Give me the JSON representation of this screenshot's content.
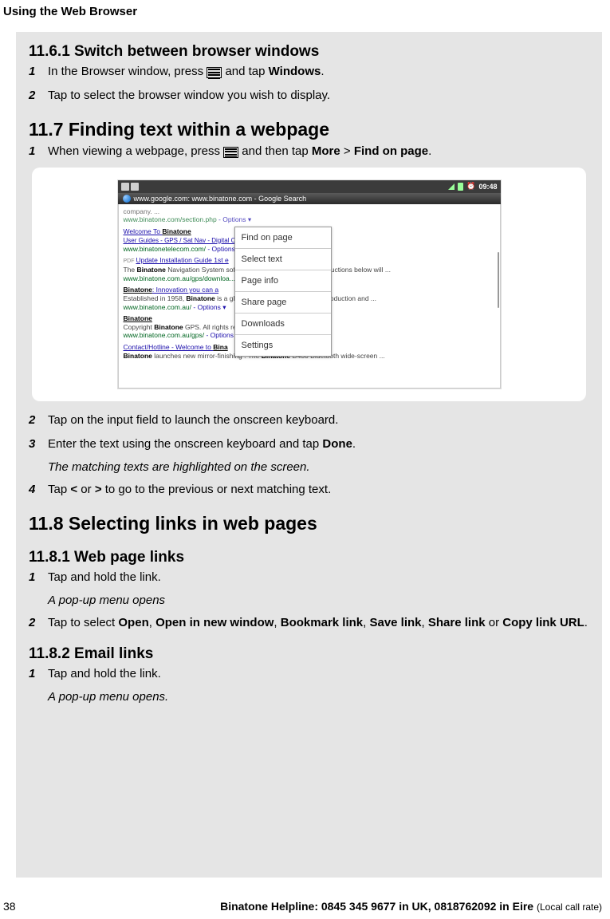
{
  "header": {
    "title": "Using the Web Browser"
  },
  "s1161": {
    "heading": "11.6.1 Switch between browser windows",
    "step1_a": "In the Browser window, press ",
    "step1_b": " and tap ",
    "step1_bold": "Windows",
    "step1_c": ".",
    "step2": "Tap to select the browser window you wish to display."
  },
  "s117": {
    "heading": "11.7   Finding text within a webpage",
    "step1_a": "When viewing a webpage, press ",
    "step1_b": "  and then tap ",
    "step1_bold1": "More",
    "step1_gt": " > ",
    "step1_bold2": "Find on page",
    "step1_c": ".",
    "step2": "Tap on the input field to launch the onscreen keyboard.",
    "step3_a": "Enter the text using the onscreen keyboard and tap ",
    "step3_bold": "Done",
    "step3_b": ".",
    "result3": "The matching texts are highlighted on the screen.",
    "step4_a": "Tap ",
    "step4_lt": "<",
    "step4_or": " or ",
    "step4_gt2": ">",
    "step4_b": " to go to the previous or next matching text."
  },
  "s118": {
    "heading": "11.8   Selecting links in web pages"
  },
  "s1181": {
    "heading": "11.8.1 Web page links",
    "step1": "Tap and hold the link.",
    "result1": "A pop-up menu opens",
    "step2_a": "Tap to select ",
    "o1": "Open",
    "c1": ", ",
    "o2": "Open in new window",
    "c2": ", ",
    "o3": "Bookmark link",
    "c3": ", ",
    "o4": "Save link",
    "c4": ", ",
    "o5": "Share link",
    "c5": " or ",
    "o6": "Copy link URL",
    "c6": "."
  },
  "s1182": {
    "heading": "11.8.2 Email links",
    "step1": "Tap and hold the link.",
    "result1": "A pop-up menu opens."
  },
  "screenshot": {
    "status_time": "09:48",
    "titlebar": "www.google.com: www.binatone.com - Google Search",
    "menu": [
      "Find on page",
      "Select text",
      "Page info",
      "Share page",
      "Downloads",
      "Settings"
    ],
    "bg": {
      "line0a": "company. ...",
      "line0b": "www.binatone.com/section.php",
      "opts": " - Options ▾",
      "r1_title_a": "Welcome To ",
      "r1_title_b": "Binatone",
      "r1_sub": "User Guides - GPS / Sat Nav - Digital Cor",
      "r1_url": "www.binatonetelecom.com/",
      "r2_pre": "PDF ",
      "r2_title": "Update Installation Guide 1st e",
      "r2_desc_a": "The ",
      "r2_desc_b": "Binatone",
      "r2_desc_c": " Navigation System softwa                                                      and fixes. A few simple instructions below will ...",
      "r2_url": "www.binatone.com.au/gps/downloa... -",
      "r3_title_a": "Binatone",
      "r3_title_b": ": Innovation you can a",
      "r3_desc_a": "Established in 1958, ",
      "r3_desc_b": "Binatone",
      "r3_desc_c": " is a glo                                                            . Our expertise in research, production and ...",
      "r3_url": "www.binatone.com.au/",
      "r4_title": "Binatone",
      "r4_desc_a": "Copyright ",
      "r4_desc_b": "Binatone",
      "r4_desc_c": " GPS. All rights res                                    ,Gaggia.",
      "r4_url": "www.binatone.com.au/gps/",
      "r5_title_a": "Contact/Hotline - Welcome to ",
      "r5_title_b": "Bina",
      "r5_desc_a": "Binatone",
      "r5_desc_b": " launches new mirror-finishing                                           . The ",
      "r5_desc_c": "Binatone",
      "r5_desc_d": " D430 Bluetooth wide-screen ..."
    }
  },
  "footer": {
    "page": "38",
    "helpline": "Binatone Helpline: 0845 345 9677 in UK, 0818762092 in Eire ",
    "local": "(Local call rate)"
  }
}
